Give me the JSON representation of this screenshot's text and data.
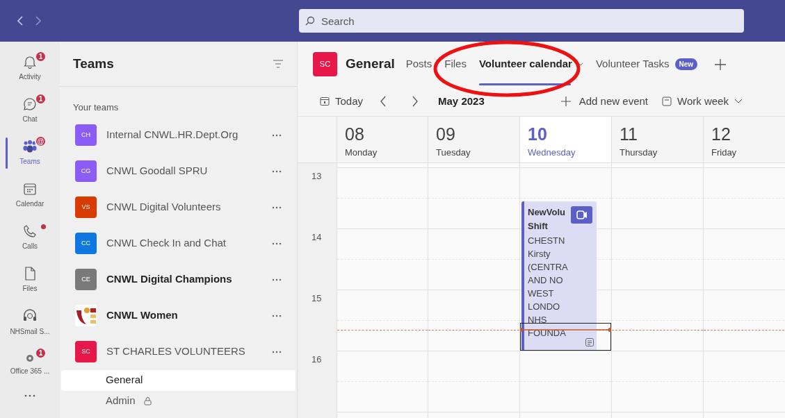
{
  "search": {
    "placeholder": "Search"
  },
  "rail": [
    {
      "label": "Activity",
      "badge": "1",
      "dot": false,
      "selected": false
    },
    {
      "label": "Chat",
      "badge": "1",
      "dot": false,
      "selected": false
    },
    {
      "label": "Teams",
      "badge": "@",
      "dot": false,
      "selected": true
    },
    {
      "label": "Calendar",
      "dot": false,
      "selected": false
    },
    {
      "label": "Calls",
      "dot": true,
      "selected": false
    },
    {
      "label": "Files",
      "dot": false,
      "selected": false
    },
    {
      "label": "NHSmail S...",
      "dot": false,
      "selected": false
    },
    {
      "label": "Office 365 ...",
      "badge": "1",
      "dot": false,
      "selected": false
    }
  ],
  "teams_panel": {
    "title": "Teams",
    "section": "Your teams",
    "teams": [
      {
        "kind": "initials",
        "initials": "CH",
        "name": "Internal CNWL.HR.Dept.Org",
        "color": "#8b5cf6",
        "unread": false
      },
      {
        "kind": "initials",
        "initials": "CG",
        "name": "CNWL Goodall SPRU",
        "color": "#8b5cf6",
        "unread": false
      },
      {
        "kind": "initials",
        "initials": "VS",
        "name": "CNWL Digital Volunteers",
        "color": "#d83b01",
        "unread": false
      },
      {
        "kind": "initials",
        "initials": "CC",
        "name": "CNWL Check In and Chat",
        "color": "#0f78e0",
        "unread": false
      },
      {
        "kind": "initials",
        "initials": "CE",
        "name": "CNWL Digital Champions",
        "color": "#7a7a7a",
        "unread": true
      },
      {
        "kind": "picture",
        "name": "CNWL Women",
        "unread": true
      },
      {
        "kind": "initials",
        "initials": "SC",
        "name": "ST CHARLES VOLUNTEERS",
        "color": "#e8174a",
        "unread": false,
        "channels": [
          {
            "name": "General",
            "selected": true,
            "private": false
          },
          {
            "name": "Admin",
            "selected": false,
            "private": true
          }
        ]
      }
    ]
  },
  "channel": {
    "initials": "SC",
    "color": "#e8174a",
    "name": "General",
    "tabs": [
      {
        "label": "Posts",
        "selected": false
      },
      {
        "label": "Files",
        "selected": false
      },
      {
        "label": "Volunteer calendar",
        "selected": true,
        "dropdown": true
      },
      {
        "label": "Volunteer Tasks",
        "selected": false,
        "badge": "New"
      }
    ]
  },
  "toolbar": {
    "today": "Today",
    "month": "May 2023",
    "add": "Add new event",
    "view": "Work week"
  },
  "hours": [
    "13",
    "14",
    "15",
    "16"
  ],
  "days": [
    {
      "date": "08",
      "day": "Monday",
      "today": false
    },
    {
      "date": "09",
      "day": "Tuesday",
      "today": false
    },
    {
      "date": "10",
      "day": "Wednesday",
      "today": true,
      "events": [
        {
          "title_lines": [
            "NewVolu",
            "Shift"
          ],
          "body_lines": [
            "CHESTN",
            "Kirsty",
            "(CENTRA",
            "AND NO",
            "WEST",
            "LONDO",
            "NHS",
            "FOUNDA"
          ]
        }
      ]
    },
    {
      "date": "11",
      "day": "Thursday",
      "today": false
    },
    {
      "date": "12",
      "day": "Friday",
      "today": false
    }
  ]
}
